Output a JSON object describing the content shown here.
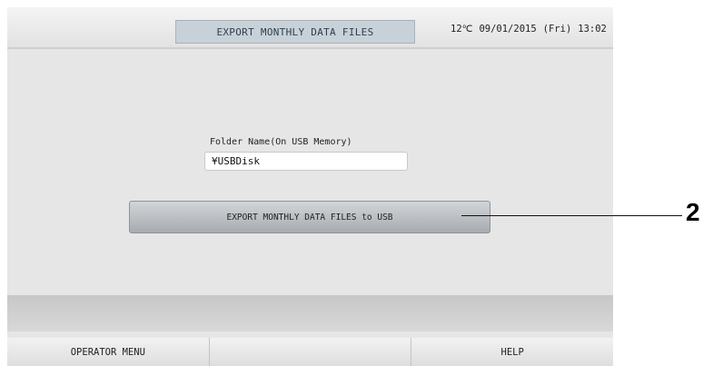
{
  "header": {
    "title": "EXPORT MONTHLY DATA FILES",
    "temperature": "12℃",
    "date": "09/01/2015",
    "day": "(Fri)",
    "time": "13:02"
  },
  "folder": {
    "label": "Folder Name(On USB Memory)",
    "value": "¥USBDisk"
  },
  "export_button": {
    "label": "EXPORT MONTHLY DATA FILES to USB"
  },
  "footer": {
    "items": [
      {
        "label": "OPERATOR MENU"
      },
      {
        "label": ""
      },
      {
        "label": "HELP"
      }
    ]
  },
  "callout": {
    "number": "2"
  }
}
